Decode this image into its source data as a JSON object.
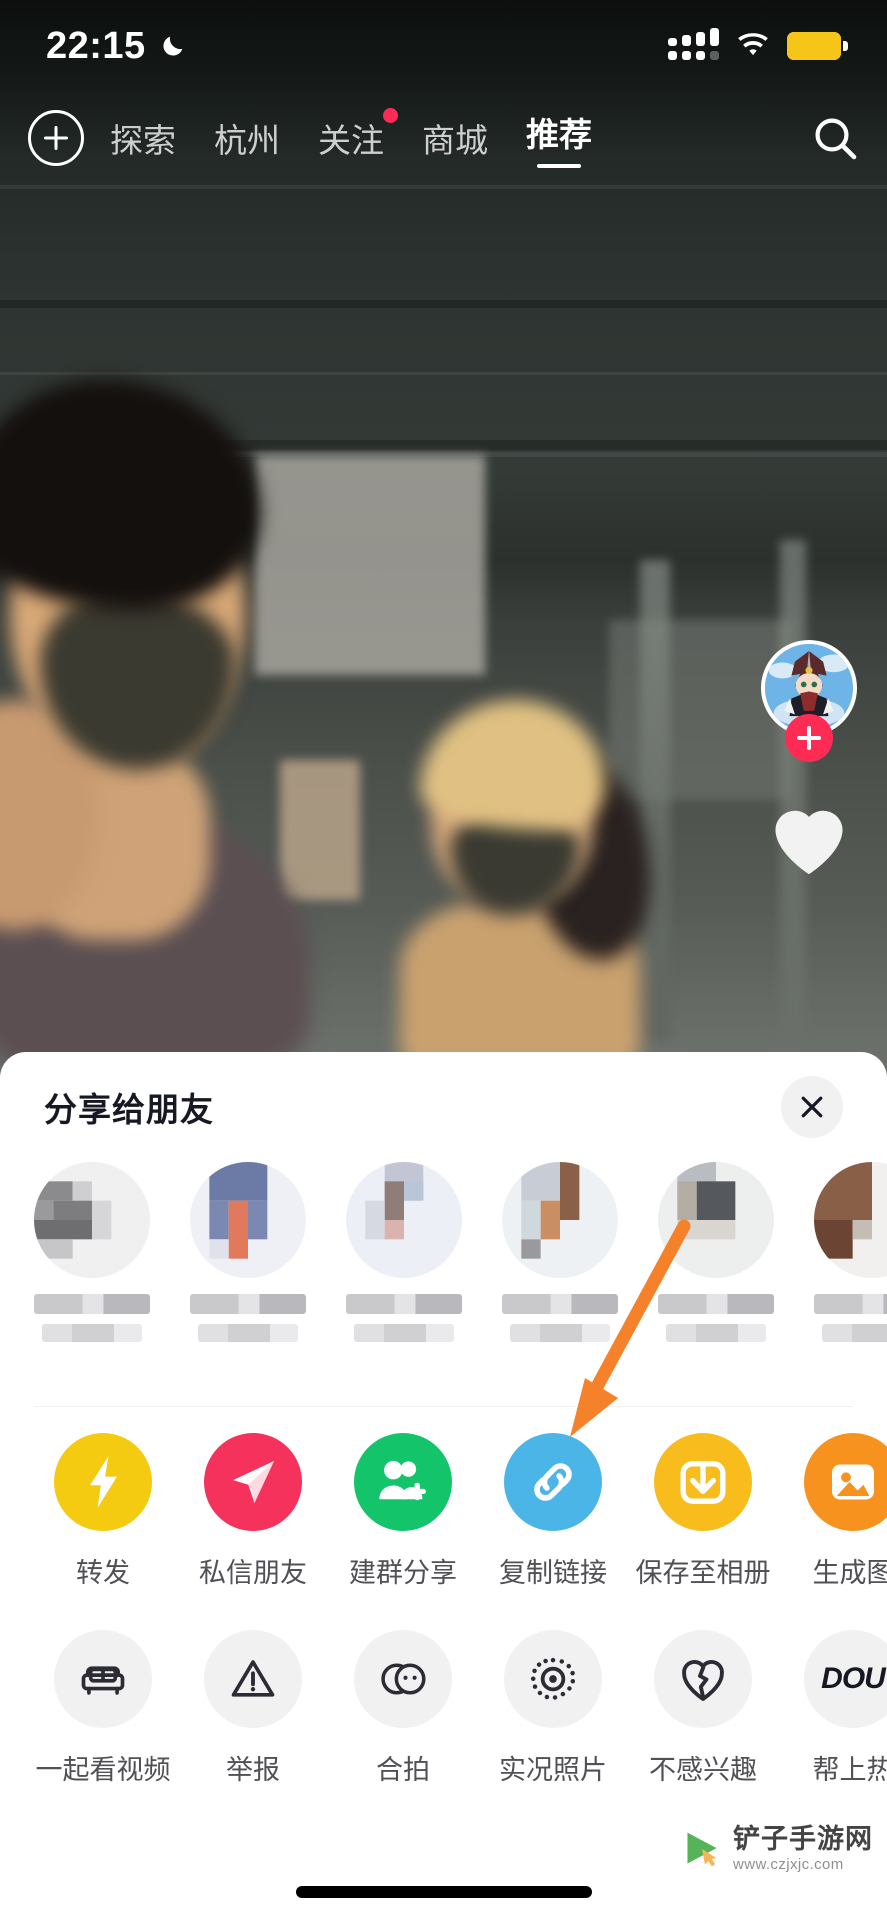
{
  "status_bar": {
    "time": "22:15",
    "moon_icon": "moon-icon",
    "signal_icon": "signal-icon",
    "wifi_icon": "wifi-icon",
    "battery_icon": "battery-icon",
    "battery_color": "#f5c518"
  },
  "top_nav": {
    "add_icon": "plus-circle-icon",
    "search_icon": "search-icon",
    "tabs": [
      {
        "label": "探索",
        "active": false,
        "dot": false
      },
      {
        "label": "杭州",
        "active": false,
        "dot": false
      },
      {
        "label": "关注",
        "active": false,
        "dot": true
      },
      {
        "label": "商城",
        "active": false,
        "dot": false
      },
      {
        "label": "推荐",
        "active": true,
        "dot": false
      }
    ],
    "badge_color": "#fe2c55"
  },
  "right_rail": {
    "avatar_name": "author-avatar",
    "follow_label": "+",
    "follow_color": "#fe2c55",
    "like_icon": "heart-icon"
  },
  "share_sheet": {
    "title": "分享给朋友",
    "close_icon": "close-icon",
    "friends": [
      {
        "name": "friend-1"
      },
      {
        "name": "friend-2"
      },
      {
        "name": "friend-3"
      },
      {
        "name": "friend-4"
      },
      {
        "name": "friend-5"
      },
      {
        "name": "friend-6"
      }
    ],
    "actions_primary": [
      {
        "label": "转发",
        "icon": "lightning-icon",
        "color": "#f5cb12"
      },
      {
        "label": "私信朋友",
        "icon": "paper-plane-icon",
        "color": "#f5325b"
      },
      {
        "label": "建群分享",
        "icon": "add-group-icon",
        "color": "#14c46a"
      },
      {
        "label": "复制链接",
        "icon": "link-icon",
        "color": "#4cb5e8"
      },
      {
        "label": "保存至相册",
        "icon": "download-icon",
        "color": "#f8bc1c"
      },
      {
        "label": "生成图",
        "icon": "image-icon",
        "color": "#f7921e"
      }
    ],
    "actions_secondary": [
      {
        "label": "一起看视频",
        "icon": "sofa-icon"
      },
      {
        "label": "举报",
        "icon": "warning-icon"
      },
      {
        "label": "合拍",
        "icon": "duet-icon"
      },
      {
        "label": "实况照片",
        "icon": "live-photo-icon"
      },
      {
        "label": "不感兴趣",
        "icon": "broken-heart-icon"
      },
      {
        "label": "帮上热",
        "icon": "douyin-text-icon"
      }
    ]
  },
  "annotation": {
    "arrow_color": "#f5822a",
    "points_to": "复制链接"
  },
  "watermark": {
    "name": "铲子手游网",
    "url": "www.czjxjc.com",
    "icon": "cursor-play-icon"
  },
  "home_indicator": "home-indicator"
}
